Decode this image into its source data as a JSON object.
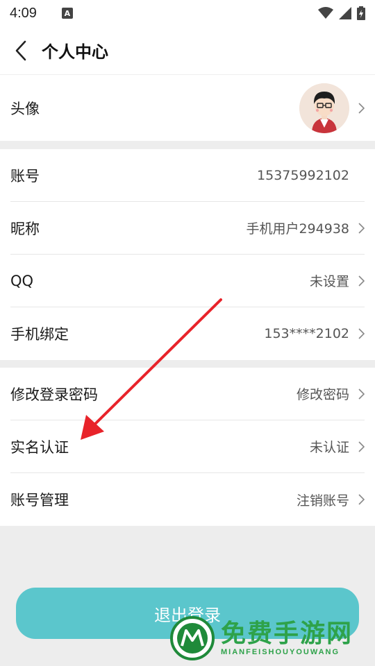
{
  "status_bar": {
    "time": "4:09",
    "notification_badge": "A"
  },
  "header": {
    "title": "个人中心",
    "back_icon": "chevron-left-icon"
  },
  "avatar_row": {
    "label": "头像"
  },
  "account_section": {
    "rows": [
      {
        "label": "账号",
        "value": "15375992102",
        "has_chevron": false
      },
      {
        "label": "昵称",
        "value": "手机用户294938",
        "has_chevron": true
      },
      {
        "label": "QQ",
        "value": "未设置",
        "has_chevron": true
      },
      {
        "label": "手机绑定",
        "value": "153****2102",
        "has_chevron": true
      }
    ]
  },
  "security_section": {
    "rows": [
      {
        "label": "修改登录密码",
        "value": "修改密码",
        "has_chevron": true
      },
      {
        "label": "实名认证",
        "value": "未认证",
        "has_chevron": true
      },
      {
        "label": "账号管理",
        "value": "注销账号",
        "has_chevron": true
      }
    ]
  },
  "logout_button": {
    "label": "退出登录",
    "color": "#5bc6cc"
  },
  "annotation": {
    "arrow_color": "#e8232a",
    "points_to": "实名认证"
  },
  "watermark": {
    "text_cn": "免费手游网",
    "text_en": "MIANFEISHOUYOUWANG",
    "color": "#2ea24a"
  }
}
